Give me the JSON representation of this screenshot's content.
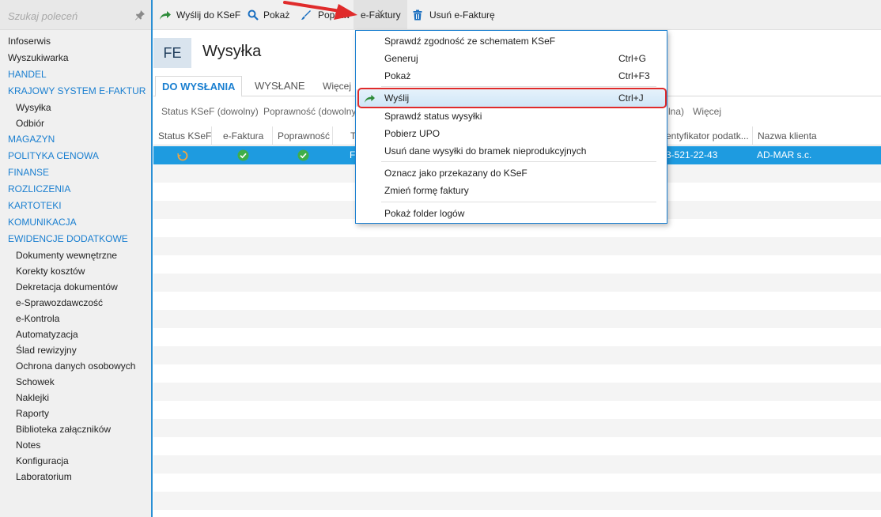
{
  "search": {
    "placeholder": "Szukaj poleceń",
    "icon": "pin-icon"
  },
  "sidebar": {
    "items": [
      {
        "label": "Infoserwis",
        "kind": "plain"
      },
      {
        "label": "Wyszukiwarka",
        "kind": "plain"
      },
      {
        "label": "HANDEL",
        "kind": "section"
      },
      {
        "label": "KRAJOWY SYSTEM E-FAKTUR",
        "kind": "section"
      },
      {
        "label": "Wysyłka",
        "kind": "sub"
      },
      {
        "label": "Odbiór",
        "kind": "sub"
      },
      {
        "label": "MAGAZYN",
        "kind": "section"
      },
      {
        "label": "POLITYKA CENOWA",
        "kind": "section"
      },
      {
        "label": "FINANSE",
        "kind": "section"
      },
      {
        "label": "ROZLICZENIA",
        "kind": "section"
      },
      {
        "label": "KARTOTEKI",
        "kind": "section"
      },
      {
        "label": "KOMUNIKACJA",
        "kind": "section"
      },
      {
        "label": "EWIDENCJE DODATKOWE",
        "kind": "section"
      },
      {
        "label": "Dokumenty wewnętrzne",
        "kind": "sub"
      },
      {
        "label": "Korekty kosztów",
        "kind": "sub"
      },
      {
        "label": "Dekretacja dokumentów",
        "kind": "sub"
      },
      {
        "label": "e-Sprawozdawczość",
        "kind": "sub"
      },
      {
        "label": "e-Kontrola",
        "kind": "sub"
      },
      {
        "label": "Automatyzacja",
        "kind": "sub"
      },
      {
        "label": "Ślad rewizyjny",
        "kind": "sub"
      },
      {
        "label": "Ochrona danych osobowych",
        "kind": "sub"
      },
      {
        "label": "Schowek",
        "kind": "sub"
      },
      {
        "label": "Naklejki",
        "kind": "sub"
      },
      {
        "label": "Raporty",
        "kind": "sub"
      },
      {
        "label": "Biblioteka załączników",
        "kind": "sub"
      },
      {
        "label": "Notes",
        "kind": "sub"
      },
      {
        "label": "Konfiguracja",
        "kind": "sub"
      },
      {
        "label": "Laboratorium",
        "kind": "sub"
      }
    ]
  },
  "toolbar": {
    "send_ksef": "Wyślij do KSeF",
    "show": "Pokaż",
    "fix": "Popraw",
    "efaktury": "e-Faktury",
    "delete": "Usuń e-Fakturę"
  },
  "header": {
    "badge": "FE",
    "title": "Wysyłka"
  },
  "tabs": {
    "to_send": "DO WYSŁANIA",
    "sent": "WYSŁANE",
    "more": "Więcej"
  },
  "filters": {
    "status": "Status KSeF (dowolny)",
    "correctness": "Poprawność (dowolny)",
    "partial": "lna)",
    "more": "Więcej"
  },
  "grid": {
    "columns": {
      "status": "Status KSeF",
      "efaktura": "e-Faktura",
      "correctness": "Poprawność",
      "type_partial": "T",
      "tax_id": "entyfikator podatk...",
      "client": "Nazwa klienta"
    },
    "row": {
      "type_partial": "F",
      "tax_id": "3-521-22-43",
      "client": "AD-MAR s.c."
    }
  },
  "menu": {
    "check_schema": "Sprawdź zgodność ze schematem KSeF",
    "generate": "Generuj",
    "generate_sc": "Ctrl+G",
    "show": "Pokaż",
    "show_sc": "Ctrl+F3",
    "send": "Wyślij",
    "send_sc": "Ctrl+J",
    "check_status": "Sprawdź status wysyłki",
    "get_upo": "Pobierz UPO",
    "delete_data": "Usuń dane wysyłki do bramek nieprodukcyjnych",
    "mark_sent": "Oznacz jako przekazany do KSeF",
    "change_form": "Zmień formę faktury",
    "show_logs": "Pokaż folder logów"
  },
  "colors": {
    "accent": "#1a7fd0",
    "selected_row": "#1e9be0",
    "annotation": "#e02b2b"
  }
}
